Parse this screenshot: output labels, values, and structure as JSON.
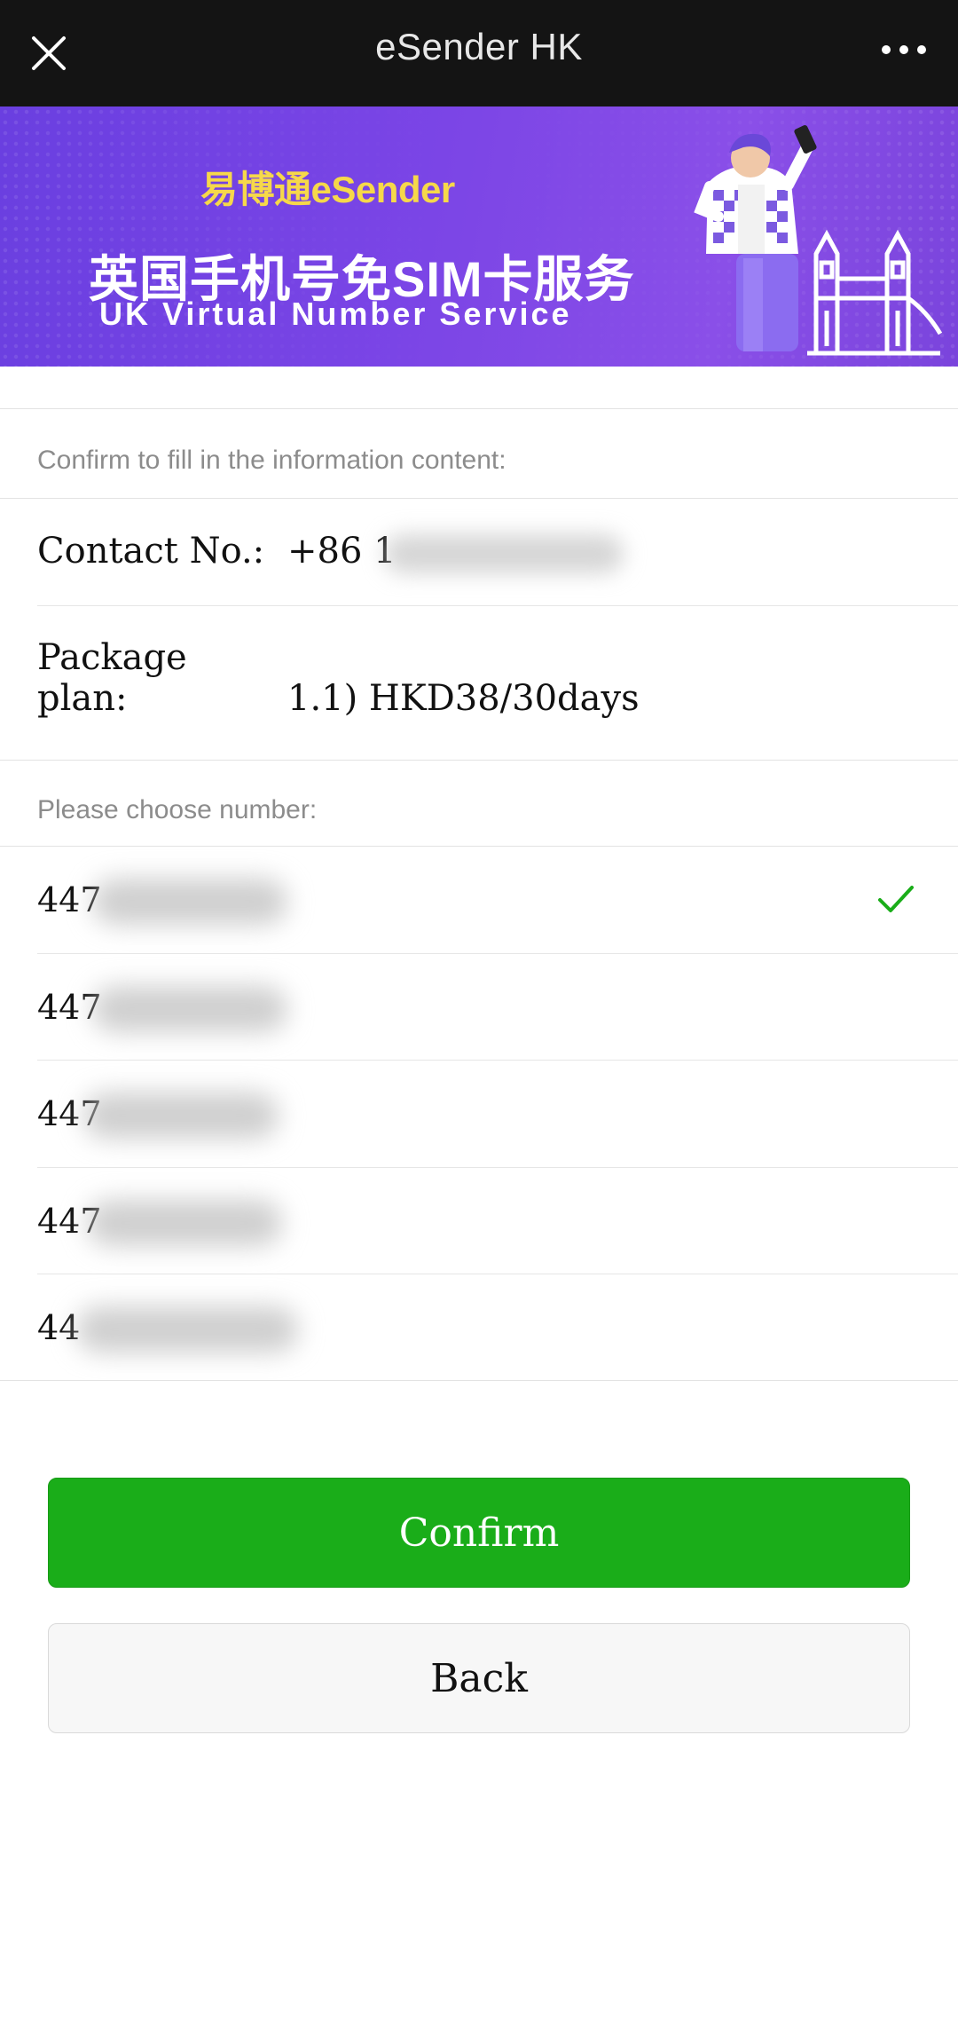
{
  "topbar": {
    "title": "eSender HK",
    "close_icon": "close-icon",
    "more_icon": "more-dots-icon"
  },
  "banner": {
    "brand": "易博通eSender",
    "title_cn": "英国手机号免SIM卡服务",
    "title_en": "UK Virtual Number Service",
    "colors": {
      "background": "#7b45e6",
      "brand": "#f6d84a"
    }
  },
  "info": {
    "section_label": "Confirm to fill in the information content:",
    "contact_label": "Contact No.:",
    "contact_value": "+86 1",
    "package_label": "Package plan:",
    "package_value": "1.1) HKD38/30days"
  },
  "numbers": {
    "section_label": "Please choose number:",
    "items": [
      {
        "prefix": "447",
        "selected": true
      },
      {
        "prefix": "447",
        "selected": false
      },
      {
        "prefix": "447",
        "selected": false
      },
      {
        "prefix": "447",
        "selected": false
      },
      {
        "prefix": "44",
        "selected": false
      }
    ],
    "check_color": "#1aad19"
  },
  "buttons": {
    "confirm_label": "Confirm",
    "back_label": "Back",
    "confirm_color": "#1aad19"
  }
}
